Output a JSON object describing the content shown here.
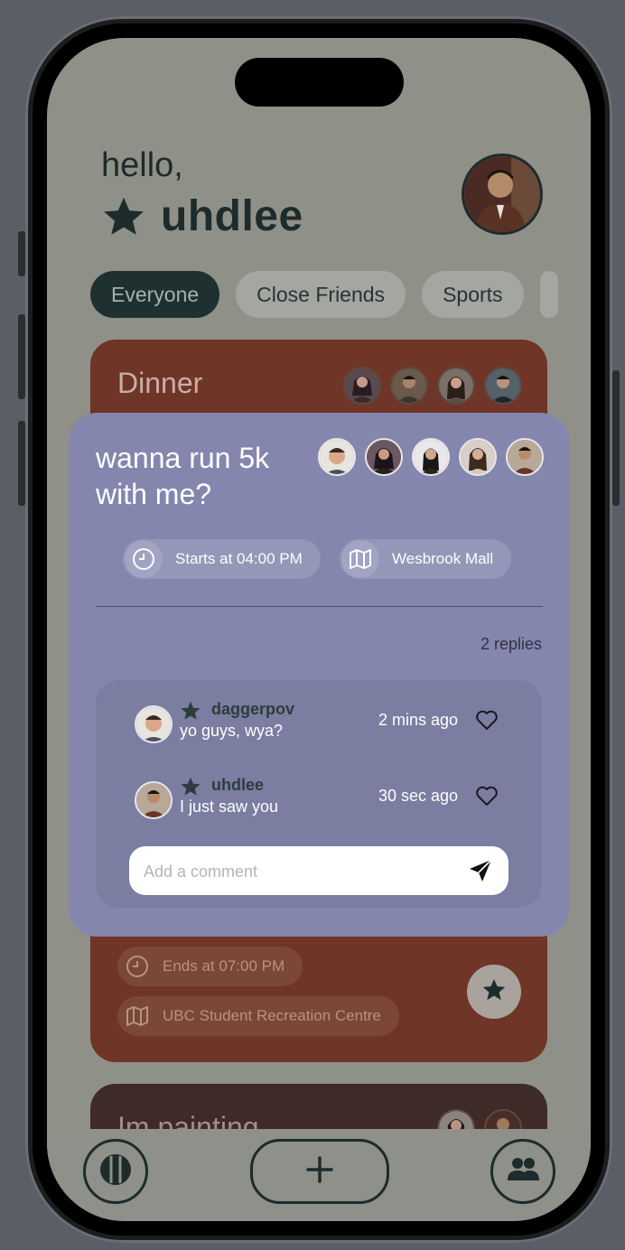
{
  "header": {
    "greeting": "hello,",
    "username": "uhdlee"
  },
  "filters": [
    {
      "label": "Everyone",
      "active": true
    },
    {
      "label": "Close Friends",
      "active": false
    },
    {
      "label": "Sports",
      "active": false
    }
  ],
  "background_cards": {
    "dinner": {
      "title": "Dinner",
      "end_time": "Ends at 07:00 PM",
      "location": "UBC Student Recreation Centre"
    },
    "painting": {
      "title": "Im painting"
    }
  },
  "modal": {
    "title": "wanna run 5k with me?",
    "start_time": "Starts at 04:00 PM",
    "location": "Wesbrook Mall",
    "replies_count": "2 replies",
    "comments": [
      {
        "user": "daggerpov",
        "text": "yo guys, wya?",
        "time": "2 mins ago"
      },
      {
        "user": "uhdlee",
        "text": "I just saw you",
        "time": "30 sec ago"
      }
    ],
    "comment_placeholder": "Add a comment"
  },
  "colors": {
    "dark_teal": "#1d2b2b",
    "modal_bg": "#8486ad",
    "dinner_card": "#6f3527",
    "painting_card": "#3e2a27"
  },
  "icons": {
    "star": "star-icon",
    "clock": "clock-icon",
    "map": "map-icon",
    "heart": "heart-icon",
    "send": "send-icon",
    "feed": "feed-icon",
    "add": "plus-icon",
    "friends": "friends-icon"
  }
}
